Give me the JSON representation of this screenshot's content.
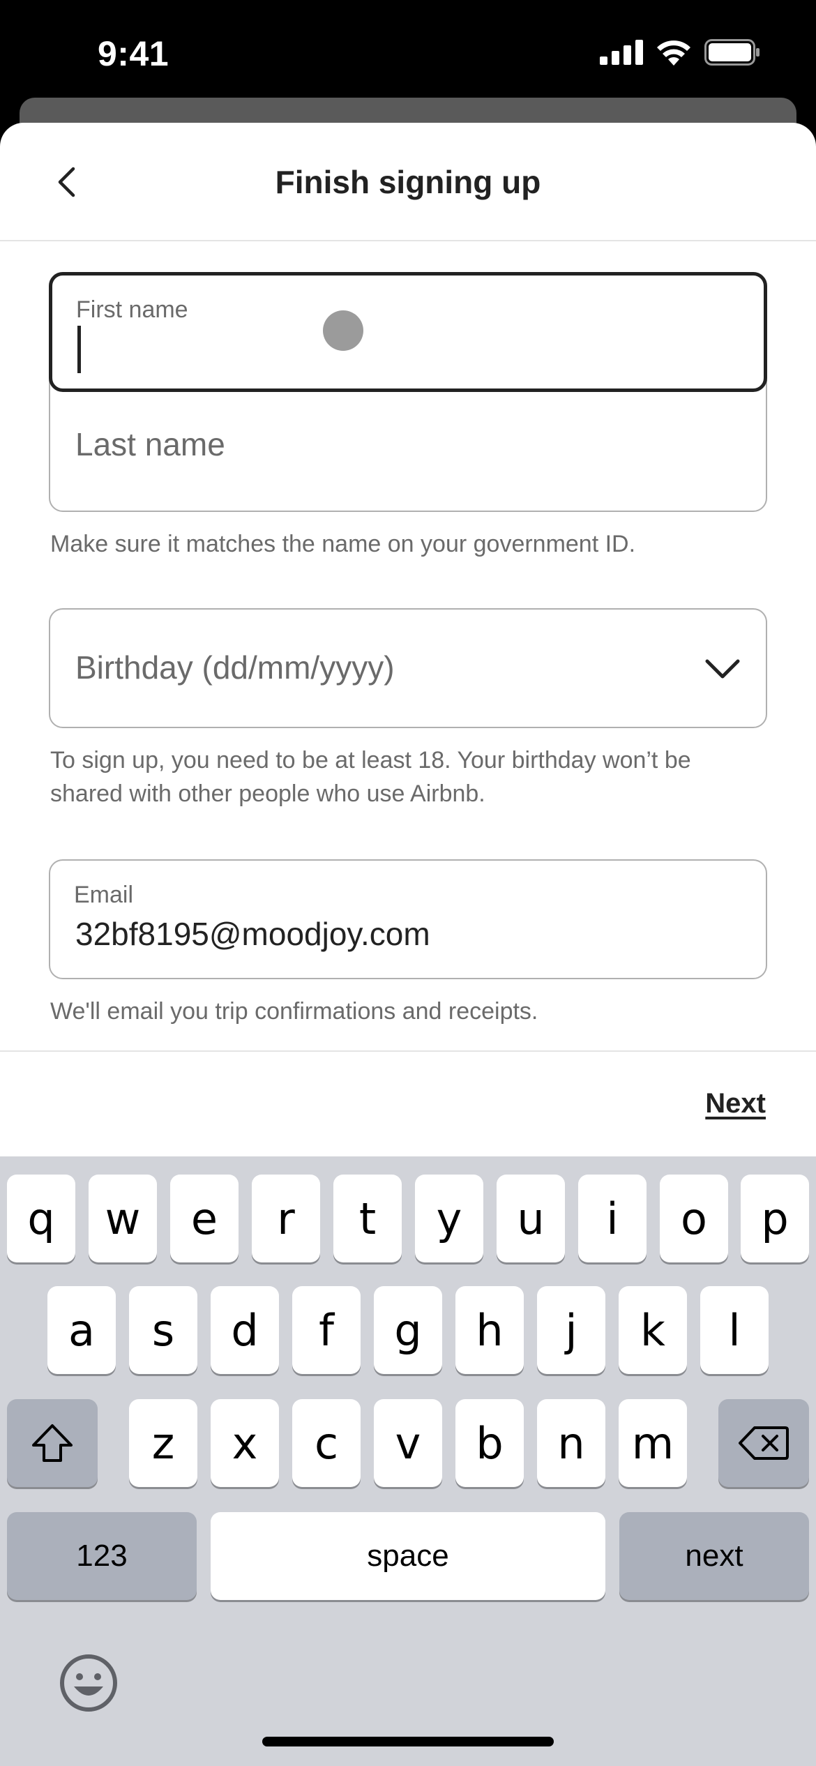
{
  "status_bar": {
    "time": "9:41"
  },
  "header": {
    "title": "Finish signing up"
  },
  "form": {
    "first_name": {
      "label": "First name",
      "value": ""
    },
    "last_name": {
      "placeholder": "Last name"
    },
    "name_helper": "Make sure it matches the name on your government ID.",
    "birthday": {
      "placeholder": "Birthday (dd/mm/yyyy)"
    },
    "birthday_helper_line1": "To sign up, you need to be at least 18. Your birthday won’t be",
    "birthday_helper_line2": "shared with other people who use Airbnb.",
    "email": {
      "label": "Email",
      "value": "32bf8195@moodjoy.com"
    },
    "email_helper": "We'll email you trip confirmations and receipts."
  },
  "footer": {
    "next_label": "Next"
  },
  "keyboard": {
    "row1": [
      "q",
      "w",
      "e",
      "r",
      "t",
      "y",
      "u",
      "i",
      "o",
      "p"
    ],
    "row2": [
      "a",
      "s",
      "d",
      "f",
      "g",
      "h",
      "j",
      "k",
      "l"
    ],
    "row3": [
      "z",
      "x",
      "c",
      "v",
      "b",
      "n",
      "m"
    ],
    "numbers_label": "123",
    "space_label": "space",
    "return_label": "next"
  },
  "colors": {
    "text": "#222222",
    "muted": "#6a6a6a",
    "border": "#b0b0b0",
    "keyboard_bg": "#d1d3d9"
  }
}
